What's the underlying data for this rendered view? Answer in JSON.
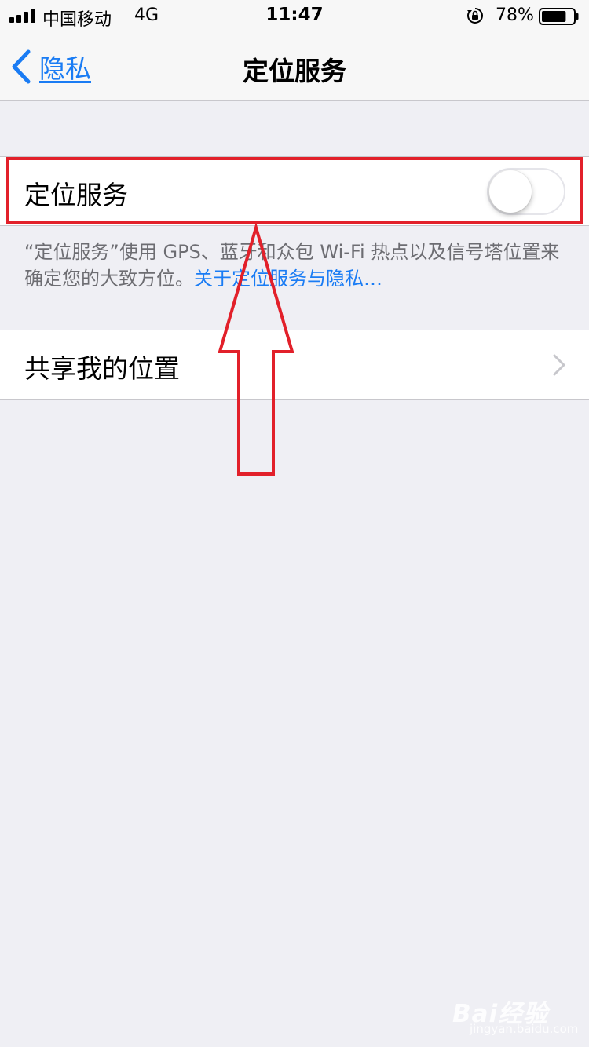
{
  "status_bar": {
    "carrier": "中国移动",
    "network": "4G",
    "time": "11:47",
    "battery_percent": "78%",
    "battery_level": 0.78,
    "icons": [
      "signal-icon",
      "orientation-lock-icon",
      "battery-icon"
    ]
  },
  "nav": {
    "back_label": "隐私",
    "title": "定位服务"
  },
  "location_row": {
    "label": "定位服务",
    "toggle_on": false
  },
  "footer": {
    "text": "“定位服务”使用 GPS、蓝牙和众包 Wi-Fi 热点以及信号塔位置来确定您的大致方位。",
    "link": "关于定位服务与隐私…"
  },
  "share_row": {
    "label": "共享我的位置"
  },
  "watermark": {
    "text": "Bai经验",
    "subtext": "jingyan.baidu.com"
  },
  "colors": {
    "accent": "#1a7cf4",
    "annotation": "#e2202a",
    "background": "#efeff4"
  }
}
